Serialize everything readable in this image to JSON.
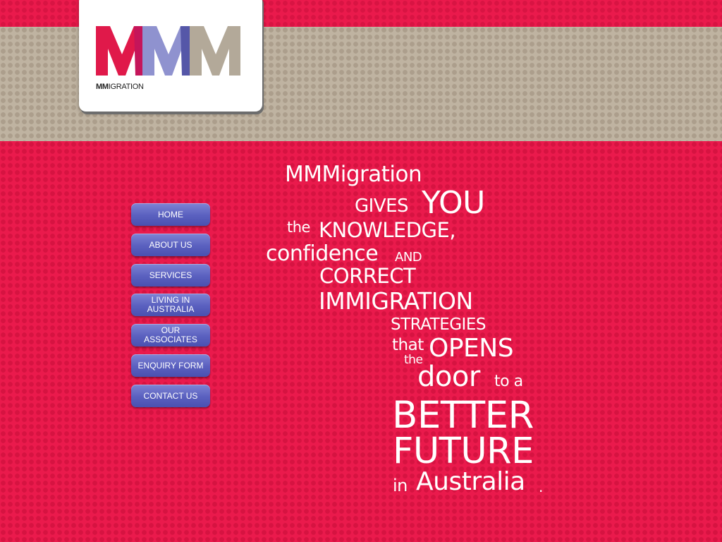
{
  "logo": {
    "letters": [
      "M",
      "M",
      "M"
    ],
    "wordmark_bold": "MM",
    "wordmark_rest": "IGRATION",
    "colors": {
      "red": "#e0194a",
      "magenta": "#c5155a",
      "periwinkle": "#8f92cf",
      "indigo": "#5557a8",
      "taupe": "#b3a999"
    }
  },
  "nav": {
    "items": [
      {
        "label": "HOME"
      },
      {
        "label": "ABOUT US"
      },
      {
        "label": "SERVICES"
      },
      {
        "label": "LIVING IN\nAUSTRALIA"
      },
      {
        "label": "OUR\nASSOCIATES"
      },
      {
        "label": "ENQUIRY FORM"
      },
      {
        "label": "CONTACT US"
      }
    ]
  },
  "tagline": {
    "w1": "MMMigration",
    "w2": "GIVES",
    "w3": "YOU",
    "w4": "the",
    "w5": "KNOWLEDGE,",
    "w6": "confidence",
    "w7": "AND",
    "w8": "CORRECT",
    "w9": "IMMIGRATION",
    "w10": "STRATEGIES",
    "w11": "that",
    "w12": "OPENS",
    "w13": "the",
    "w14": "door",
    "w15": "to a",
    "w16": "BETTER",
    "w17": "FUTURE",
    "w18": "in",
    "w19": "Australia",
    "w20": "."
  },
  "colors": {
    "background_red": "#ea1a4c",
    "band_tan": "#bfb3a1",
    "button_blue": "#5a60bf"
  }
}
